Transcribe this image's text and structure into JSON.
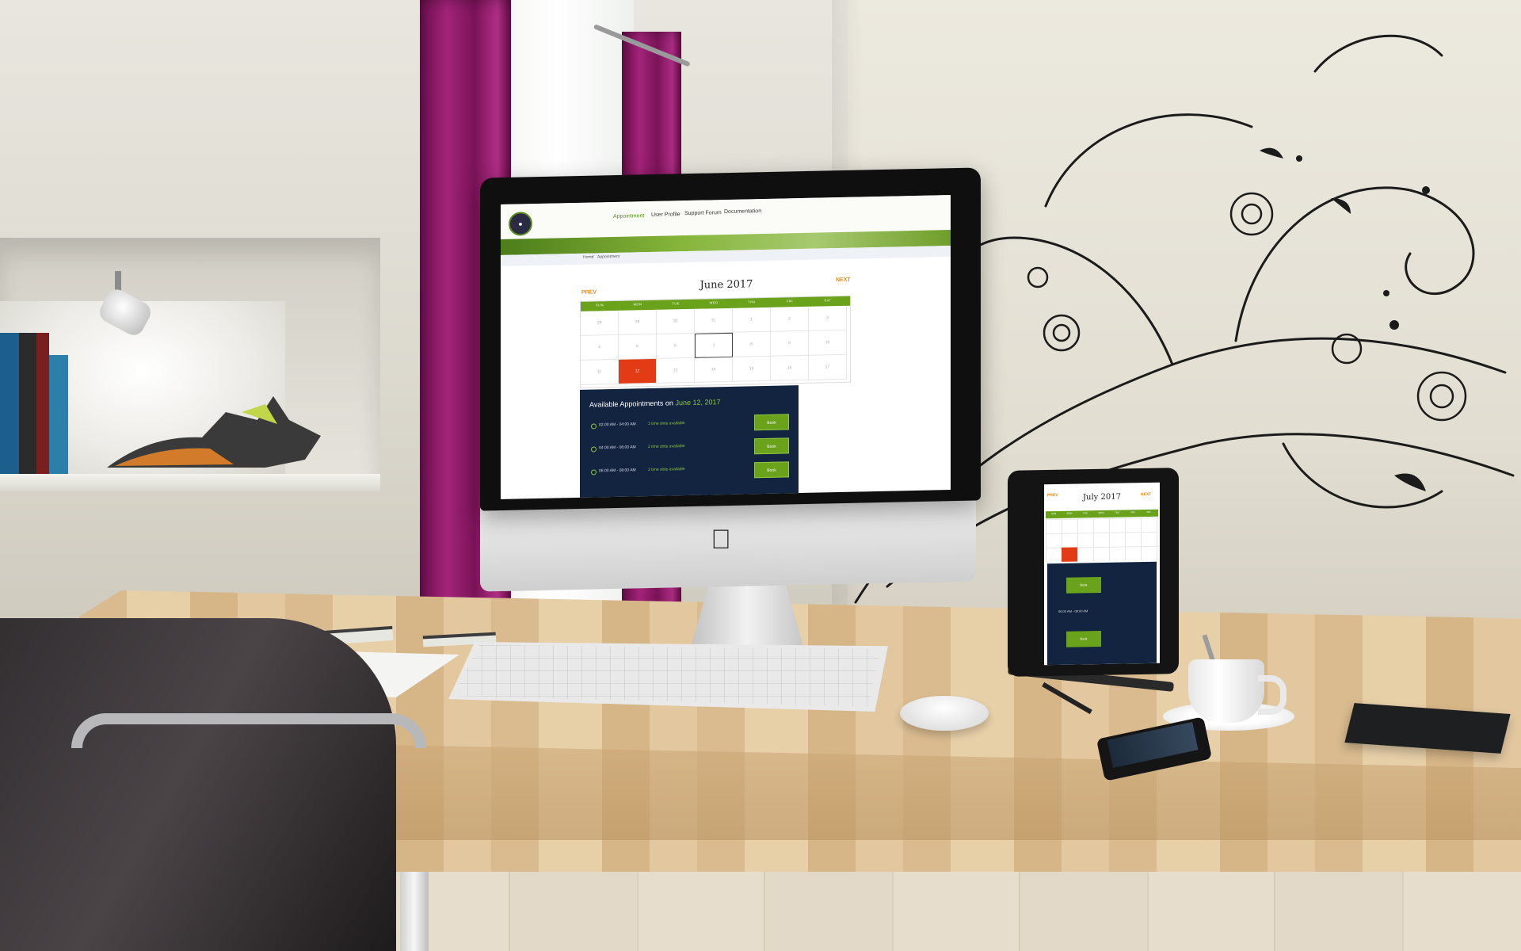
{
  "site": {
    "nav": [
      "Appointment",
      "User Profile",
      "Support Forum",
      "Documentation"
    ],
    "breadcrumb": [
      "Home",
      "/",
      "Appointment"
    ]
  },
  "calendar": {
    "prev_label": "PREV",
    "next_label": "NEXT",
    "month_title": "June 2017",
    "weekdays": [
      "SUN",
      "MON",
      "TUE",
      "WED",
      "THU",
      "FRI",
      "SAT"
    ],
    "days": [
      "28",
      "29",
      "30",
      "31",
      "1",
      "2",
      "3",
      "4",
      "5",
      "6",
      "7",
      "8",
      "9",
      "10",
      "11",
      "12",
      "13",
      "14",
      "15",
      "16",
      "17"
    ],
    "today": "12"
  },
  "appointments": {
    "title_prefix": "Available Appointments on",
    "date": "June 12, 2017",
    "slots": [
      {
        "time": "02:00 AM - 04:00 AM",
        "availability": "3 time slots available",
        "action": "Book"
      },
      {
        "time": "04:00 AM - 06:00 AM",
        "availability": "2 time slots available",
        "action": "Book"
      },
      {
        "time": "06:00 AM - 08:00 AM",
        "availability": "2 time slots available",
        "action": "Book"
      }
    ]
  },
  "tablet": {
    "prev_label": "PREV",
    "next_label": "NEXT",
    "month_title": "July 2017",
    "weekdays": [
      "SUN",
      "MON",
      "TUE",
      "WED",
      "THU",
      "FRI",
      "SAT"
    ],
    "slot_time": "06:00 AM - 08:00 AM",
    "book_label": "Book"
  },
  "colors": {
    "accent_green": "#6aa21c",
    "panel_navy": "#132441",
    "today_red": "#e23b16",
    "nav_orange": "#e58a12",
    "curtain_magenta": "#a3247a"
  },
  "icons": [
    "apple-logo-icon"
  ]
}
